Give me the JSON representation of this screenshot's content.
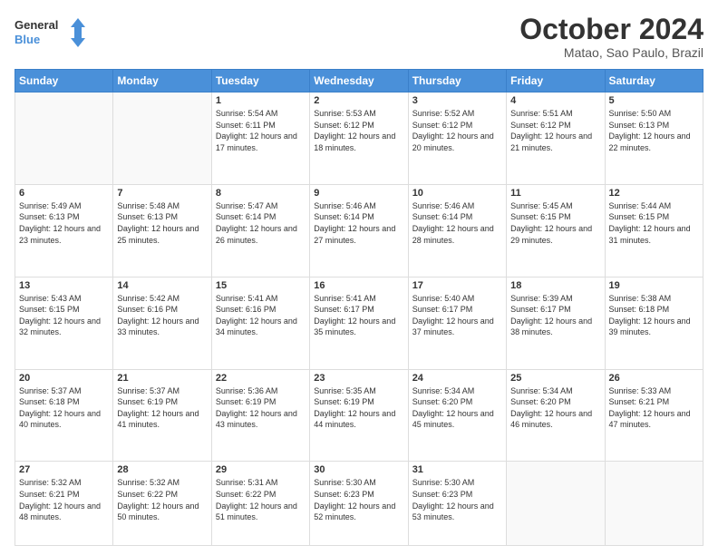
{
  "header": {
    "logo_line1": "General",
    "logo_line2": "Blue",
    "month_title": "October 2024",
    "subtitle": "Matao, Sao Paulo, Brazil"
  },
  "days_of_week": [
    "Sunday",
    "Monday",
    "Tuesday",
    "Wednesday",
    "Thursday",
    "Friday",
    "Saturday"
  ],
  "weeks": [
    [
      {
        "day": "",
        "info": ""
      },
      {
        "day": "",
        "info": ""
      },
      {
        "day": "1",
        "info": "Sunrise: 5:54 AM\nSunset: 6:11 PM\nDaylight: 12 hours and 17 minutes."
      },
      {
        "day": "2",
        "info": "Sunrise: 5:53 AM\nSunset: 6:12 PM\nDaylight: 12 hours and 18 minutes."
      },
      {
        "day": "3",
        "info": "Sunrise: 5:52 AM\nSunset: 6:12 PM\nDaylight: 12 hours and 20 minutes."
      },
      {
        "day": "4",
        "info": "Sunrise: 5:51 AM\nSunset: 6:12 PM\nDaylight: 12 hours and 21 minutes."
      },
      {
        "day": "5",
        "info": "Sunrise: 5:50 AM\nSunset: 6:13 PM\nDaylight: 12 hours and 22 minutes."
      }
    ],
    [
      {
        "day": "6",
        "info": "Sunrise: 5:49 AM\nSunset: 6:13 PM\nDaylight: 12 hours and 23 minutes."
      },
      {
        "day": "7",
        "info": "Sunrise: 5:48 AM\nSunset: 6:13 PM\nDaylight: 12 hours and 25 minutes."
      },
      {
        "day": "8",
        "info": "Sunrise: 5:47 AM\nSunset: 6:14 PM\nDaylight: 12 hours and 26 minutes."
      },
      {
        "day": "9",
        "info": "Sunrise: 5:46 AM\nSunset: 6:14 PM\nDaylight: 12 hours and 27 minutes."
      },
      {
        "day": "10",
        "info": "Sunrise: 5:46 AM\nSunset: 6:14 PM\nDaylight: 12 hours and 28 minutes."
      },
      {
        "day": "11",
        "info": "Sunrise: 5:45 AM\nSunset: 6:15 PM\nDaylight: 12 hours and 29 minutes."
      },
      {
        "day": "12",
        "info": "Sunrise: 5:44 AM\nSunset: 6:15 PM\nDaylight: 12 hours and 31 minutes."
      }
    ],
    [
      {
        "day": "13",
        "info": "Sunrise: 5:43 AM\nSunset: 6:15 PM\nDaylight: 12 hours and 32 minutes."
      },
      {
        "day": "14",
        "info": "Sunrise: 5:42 AM\nSunset: 6:16 PM\nDaylight: 12 hours and 33 minutes."
      },
      {
        "day": "15",
        "info": "Sunrise: 5:41 AM\nSunset: 6:16 PM\nDaylight: 12 hours and 34 minutes."
      },
      {
        "day": "16",
        "info": "Sunrise: 5:41 AM\nSunset: 6:17 PM\nDaylight: 12 hours and 35 minutes."
      },
      {
        "day": "17",
        "info": "Sunrise: 5:40 AM\nSunset: 6:17 PM\nDaylight: 12 hours and 37 minutes."
      },
      {
        "day": "18",
        "info": "Sunrise: 5:39 AM\nSunset: 6:17 PM\nDaylight: 12 hours and 38 minutes."
      },
      {
        "day": "19",
        "info": "Sunrise: 5:38 AM\nSunset: 6:18 PM\nDaylight: 12 hours and 39 minutes."
      }
    ],
    [
      {
        "day": "20",
        "info": "Sunrise: 5:37 AM\nSunset: 6:18 PM\nDaylight: 12 hours and 40 minutes."
      },
      {
        "day": "21",
        "info": "Sunrise: 5:37 AM\nSunset: 6:19 PM\nDaylight: 12 hours and 41 minutes."
      },
      {
        "day": "22",
        "info": "Sunrise: 5:36 AM\nSunset: 6:19 PM\nDaylight: 12 hours and 43 minutes."
      },
      {
        "day": "23",
        "info": "Sunrise: 5:35 AM\nSunset: 6:19 PM\nDaylight: 12 hours and 44 minutes."
      },
      {
        "day": "24",
        "info": "Sunrise: 5:34 AM\nSunset: 6:20 PM\nDaylight: 12 hours and 45 minutes."
      },
      {
        "day": "25",
        "info": "Sunrise: 5:34 AM\nSunset: 6:20 PM\nDaylight: 12 hours and 46 minutes."
      },
      {
        "day": "26",
        "info": "Sunrise: 5:33 AM\nSunset: 6:21 PM\nDaylight: 12 hours and 47 minutes."
      }
    ],
    [
      {
        "day": "27",
        "info": "Sunrise: 5:32 AM\nSunset: 6:21 PM\nDaylight: 12 hours and 48 minutes."
      },
      {
        "day": "28",
        "info": "Sunrise: 5:32 AM\nSunset: 6:22 PM\nDaylight: 12 hours and 50 minutes."
      },
      {
        "day": "29",
        "info": "Sunrise: 5:31 AM\nSunset: 6:22 PM\nDaylight: 12 hours and 51 minutes."
      },
      {
        "day": "30",
        "info": "Sunrise: 5:30 AM\nSunset: 6:23 PM\nDaylight: 12 hours and 52 minutes."
      },
      {
        "day": "31",
        "info": "Sunrise: 5:30 AM\nSunset: 6:23 PM\nDaylight: 12 hours and 53 minutes."
      },
      {
        "day": "",
        "info": ""
      },
      {
        "day": "",
        "info": ""
      }
    ]
  ]
}
